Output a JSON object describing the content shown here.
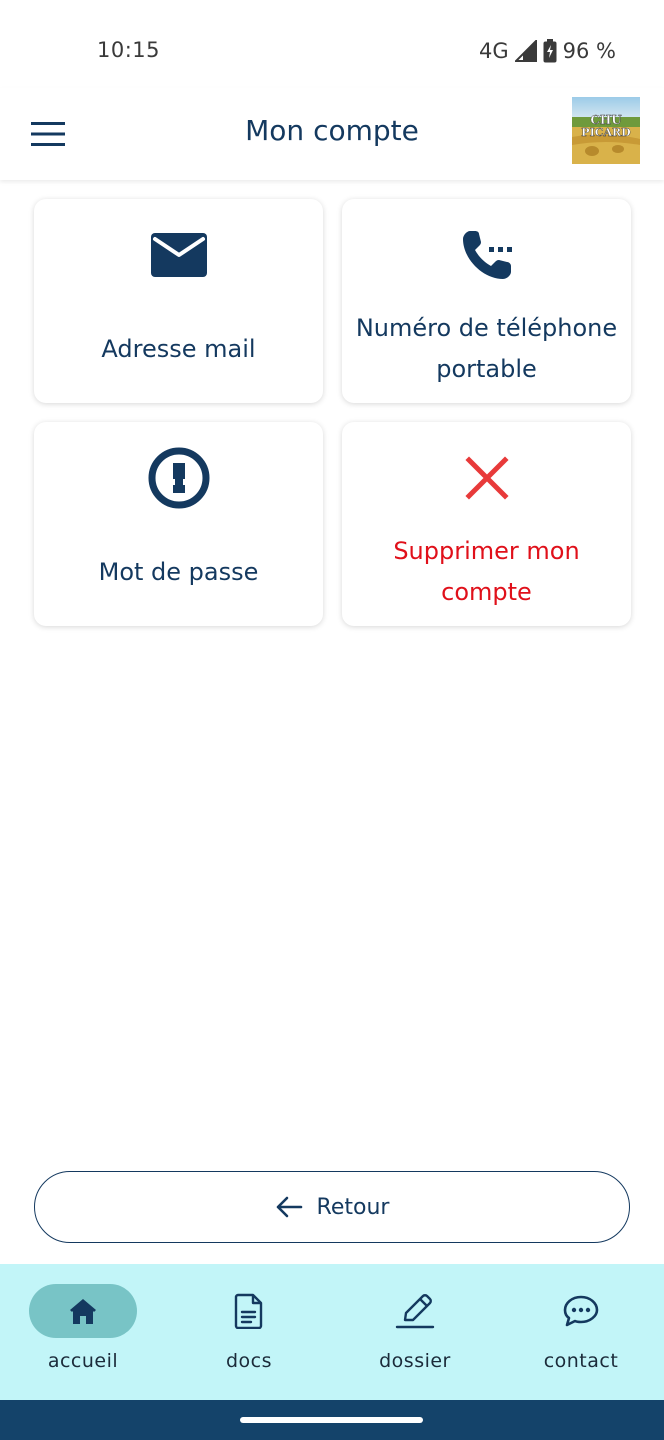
{
  "status_bar": {
    "time": "10:15",
    "network": "4G",
    "battery": "96 %",
    "icons": [
      "signal-icon",
      "battery-charging-icon"
    ]
  },
  "header": {
    "title": "Mon compte",
    "menu_icon": "hamburger-menu-icon",
    "logo_text_line1": "CHU",
    "logo_text_line2": "PICARD"
  },
  "cards": [
    {
      "label": "Adresse mail",
      "icon": "envelope-icon",
      "color": "#14395f"
    },
    {
      "label": "Numéro de téléphone portable",
      "icon": "phone-dialing-icon",
      "color": "#14395f"
    },
    {
      "label": "Mot de passe",
      "icon": "keyhole-icon",
      "color": "#14395f"
    },
    {
      "label": "Supprimer mon compte",
      "icon": "close-x-icon",
      "color": "#e0101a"
    }
  ],
  "retour_button": {
    "label": "Retour",
    "icon": "arrow-left-icon"
  },
  "bottom_nav": {
    "items": [
      {
        "label": "accueil",
        "icon": "home-icon",
        "active": true
      },
      {
        "label": "docs",
        "icon": "document-icon",
        "active": false
      },
      {
        "label": "dossier",
        "icon": "pencil-icon",
        "active": false
      },
      {
        "label": "contact",
        "icon": "chat-bubble-icon",
        "active": false
      }
    ]
  },
  "colors": {
    "primary": "#14395f",
    "danger": "#e0101a",
    "nav_background": "#c2f5f8",
    "nav_active_pill": "#78c4c6",
    "system_bar": "#14436a"
  }
}
